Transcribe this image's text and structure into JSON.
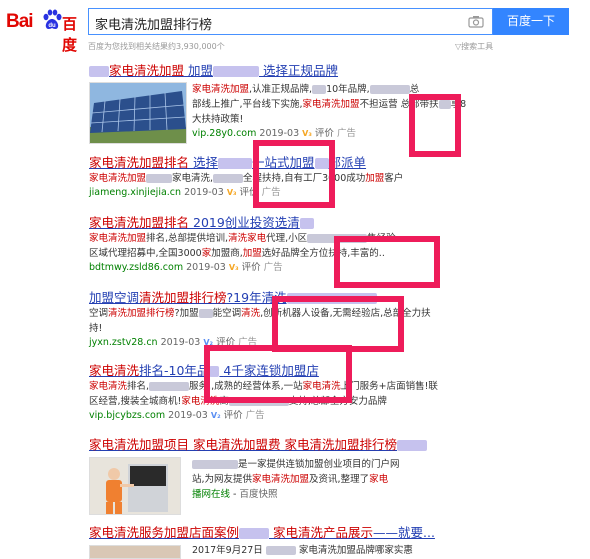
{
  "header": {
    "logo_text": "Bai",
    "logo_cn": "百度",
    "query": "家电清洗加盟排行榜",
    "search_button": "百度一下",
    "hint": "百度为您找到相关结果约3,930,000个",
    "tools": "搜索工具"
  },
  "results": [
    {
      "title_pre": "",
      "title_em": "家电清洗加盟",
      "title_post": "加盟",
      "title_tail": "选择正规品牌",
      "abstract_line1_em": "家电清洗加盟",
      "abstract_line1": "认准正规品牌,",
      "abstract_line1_b": "10年品牌,",
      "abstract_line1_c": "总",
      "abstract_line2": "部线上推广,平台线下实施,",
      "abstract_line2_em": "家电清洗加盟",
      "abstract_line2_b": "不担运营",
      "abstract_line2_c": "总部带扶",
      "abstract_line2_d": "享8",
      "abstract_line3": "大扶持政策!",
      "url": "vip.28y0.com",
      "date": "2019-03",
      "comment": "评价",
      "ad": "广告"
    },
    {
      "title_em": "家电清洗加盟排名",
      "title_mid": "选择",
      "title_tail": "一站式加盟",
      "title_end": "部派单",
      "abstract_em": "家电清洗加盟",
      "abstract": "家电清洗,",
      "abstract_b": "全程扶持,自有工厂",
      "abstract_c": "3000成功",
      "abstract_em2": "加盟",
      "abstract_d": "客户",
      "url": "jiameng.xinjiejia.cn",
      "date": "2019-03",
      "comment": "评价",
      "ad": "广告"
    },
    {
      "title_em": "家电清洗加盟排名",
      "title_post": "2019创业投资选清",
      "abstract_line1_em": "家电清洗加盟",
      "abstract_line1": "排名,总部提供培训,",
      "abstract_line1_em2": "清洗家电",
      "abstract_line1_b": "代理,小区",
      "abstract_line1_c": "售经验,",
      "abstract_line2": "区域代理招募中,全国3000",
      "abstract_line2_em": "家",
      "abstract_line2_b": "加盟商,",
      "abstract_line2_em2": "加盟",
      "abstract_line2_c": "选好品牌",
      "abstract_line2_d": "全方位扶持,丰富的..",
      "url": "bdtmwy.zsld86.com",
      "date": "2019-03",
      "comment": "评价",
      "ad": "广告"
    },
    {
      "title_pre": "加盟空调",
      "title_em": "清洗加盟排行榜",
      "title_post": "?19年清洗",
      "abstract_line1": "空调",
      "abstract_line1_em": "清洗加盟排行榜",
      "abstract_line1_b": "?加盟",
      "abstract_line1_c": "能空调",
      "abstract_line1_em2": "清洗",
      "abstract_line1_d": ",创新机器人设备,无需经验",
      "abstract_line1_e": "店,总部全力扶",
      "abstract_line2": "持!",
      "url": "jyxn.zstv28.cn",
      "date": "2019-03",
      "comment": "评价",
      "ad": "广告"
    },
    {
      "title_em": "家电清洗",
      "title_mid": "排名-10年品",
      "title_tail": "4千家连锁加盟店",
      "abstract_line1_em": "家电清洗",
      "abstract_line1": "排名,",
      "abstract_line1_b": "服务,,成熟的经营体系,一站",
      "abstract_line1_em2": "家电清洗",
      "abstract_line1_c": "上门服务+店面销售!联",
      "abstract_line2": "区经营,搜装全城商机!",
      "abstract_line2_em": "家电清洗",
      "abstract_line2_b": "商",
      "abstract_line2_c": "支持,总部全方",
      "abstract_line2_d": "安力品牌",
      "url": "vip.bjcybzs.com",
      "date": "2019-03",
      "comment": "评价",
      "ad": "广告"
    },
    {
      "title_em": "家电清洗加盟项目",
      "title_em2": "家电清洗加盟费",
      "title_em3": "家电清洗加盟排行榜",
      "abstract_line1": "是一家提供连锁加盟创业项目的门户网",
      "abstract_line2": "站,为网友提供",
      "abstract_line2_em": "家电清洗加盟",
      "abstract_line2_b": "及资讯,整理了",
      "abstract_line2_em2": "家电",
      "abstract_line3": "播网在线",
      "abstract_line3_b": "百度快照"
    },
    {
      "title_em": "家电清洗服务加盟店面案例",
      "title_em2": "家电清洗产品展示",
      "title_tail": "——就要...",
      "abstract_line1": "2017年9月27日",
      "abstract_line1_b": "家电清洗加盟品牌哪家实惠"
    }
  ]
}
